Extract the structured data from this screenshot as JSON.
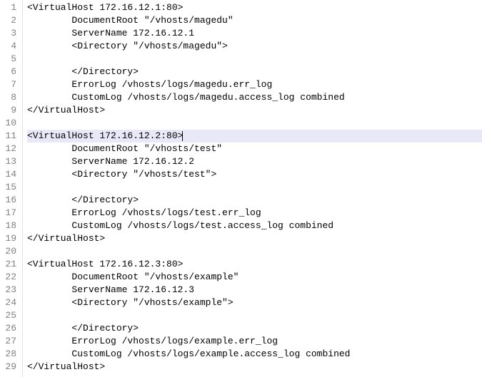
{
  "lines": [
    {
      "num": "1",
      "text": "<VirtualHost 172.16.12.1:80>",
      "hl": false
    },
    {
      "num": "2",
      "text": "        DocumentRoot \"/vhosts/magedu\"",
      "hl": false
    },
    {
      "num": "3",
      "text": "        ServerName 172.16.12.1",
      "hl": false
    },
    {
      "num": "4",
      "text": "        <Directory \"/vhosts/magedu\">",
      "hl": false
    },
    {
      "num": "5",
      "text": "",
      "hl": false
    },
    {
      "num": "6",
      "text": "        </Directory>",
      "hl": false
    },
    {
      "num": "7",
      "text": "        ErrorLog /vhosts/logs/magedu.err_log",
      "hl": false
    },
    {
      "num": "8",
      "text": "        CustomLog /vhosts/logs/magedu.access_log combined",
      "hl": false
    },
    {
      "num": "9",
      "text": "</VirtualHost>",
      "hl": false
    },
    {
      "num": "10",
      "text": "",
      "hl": false
    },
    {
      "num": "11",
      "text": "<VirtualHost 172.16.12.2:80>",
      "hl": true
    },
    {
      "num": "12",
      "text": "        DocumentRoot \"/vhosts/test\"",
      "hl": false
    },
    {
      "num": "13",
      "text": "        ServerName 172.16.12.2",
      "hl": false
    },
    {
      "num": "14",
      "text": "        <Directory \"/vhosts/test\">",
      "hl": false
    },
    {
      "num": "15",
      "text": "",
      "hl": false
    },
    {
      "num": "16",
      "text": "        </Directory>",
      "hl": false
    },
    {
      "num": "17",
      "text": "        ErrorLog /vhosts/logs/test.err_log",
      "hl": false
    },
    {
      "num": "18",
      "text": "        CustomLog /vhosts/logs/test.access_log combined",
      "hl": false
    },
    {
      "num": "19",
      "text": "</VirtualHost>",
      "hl": false
    },
    {
      "num": "20",
      "text": "",
      "hl": false
    },
    {
      "num": "21",
      "text": "<VirtualHost 172.16.12.3:80>",
      "hl": false
    },
    {
      "num": "22",
      "text": "        DocumentRoot \"/vhosts/example\"",
      "hl": false
    },
    {
      "num": "23",
      "text": "        ServerName 172.16.12.3",
      "hl": false
    },
    {
      "num": "24",
      "text": "        <Directory \"/vhosts/example\">",
      "hl": false
    },
    {
      "num": "25",
      "text": "",
      "hl": false
    },
    {
      "num": "26",
      "text": "        </Directory>",
      "hl": false
    },
    {
      "num": "27",
      "text": "        ErrorLog /vhosts/logs/example.err_log",
      "hl": false
    },
    {
      "num": "28",
      "text": "        CustomLog /vhosts/logs/example.access_log combined",
      "hl": false
    },
    {
      "num": "29",
      "text": "</VirtualHost>",
      "hl": false
    }
  ],
  "cursor_line": 11
}
